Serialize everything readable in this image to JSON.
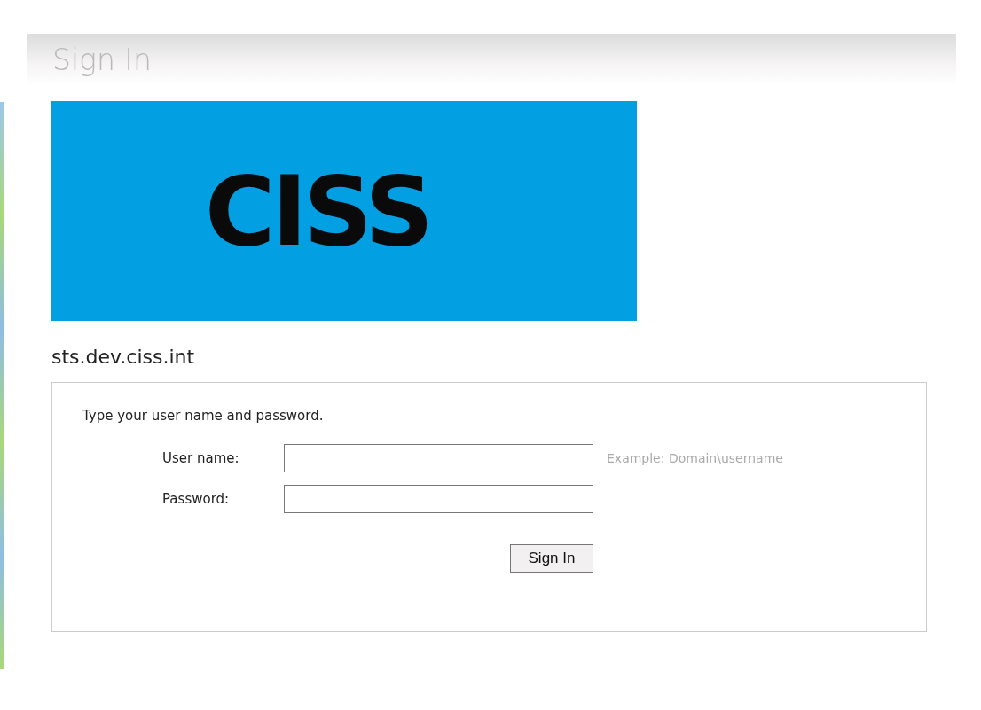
{
  "page": {
    "title": "Sign In"
  },
  "logo": {
    "text": "CISS"
  },
  "host": "sts.dev.ciss.int",
  "form": {
    "instruction": "Type your user name and password.",
    "fields": [
      {
        "label": "User name:",
        "hint": "Example: Domain\\username"
      },
      {
        "label": "Password:"
      }
    ],
    "button": "Sign In"
  }
}
